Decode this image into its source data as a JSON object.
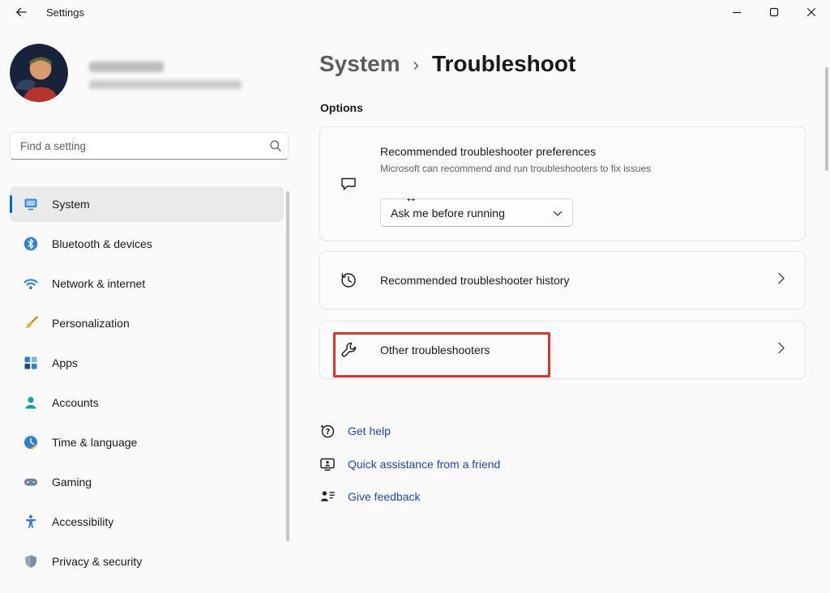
{
  "window": {
    "title": "Settings"
  },
  "sidebar": {
    "search_placeholder": "Find a setting",
    "nav_items": [
      {
        "label": "System",
        "icon": "system-monitor",
        "selected": true
      },
      {
        "label": "Bluetooth & devices",
        "icon": "bluetooth"
      },
      {
        "label": "Network & internet",
        "icon": "wifi"
      },
      {
        "label": "Personalization",
        "icon": "paintbrush"
      },
      {
        "label": "Apps",
        "icon": "apps-grid"
      },
      {
        "label": "Accounts",
        "icon": "person"
      },
      {
        "label": "Time & language",
        "icon": "clock"
      },
      {
        "label": "Gaming",
        "icon": "game-controller"
      },
      {
        "label": "Accessibility",
        "icon": "accessibility-person"
      },
      {
        "label": "Privacy & security",
        "icon": "shield"
      }
    ]
  },
  "main": {
    "breadcrumb": {
      "parent": "System",
      "separator": "›",
      "current": "Troubleshoot"
    },
    "section_title": "Options",
    "preferences_card": {
      "title": "Recommended troubleshooter preferences",
      "description": "Microsoft can recommend and run troubleshooters to fix issues",
      "dropdown_value": "Ask me before running",
      "icon": "speech-bubble"
    },
    "history_card": {
      "label": "Recommended troubleshooter history",
      "icon": "history-clock"
    },
    "other_card": {
      "label": "Other troubleshooters",
      "icon": "wrench"
    },
    "links": [
      {
        "label": "Get help",
        "icon": "help-question"
      },
      {
        "label": "Quick assistance from a friend",
        "icon": "remote-assist-screen"
      },
      {
        "label": "Give feedback",
        "icon": "feedback-person"
      }
    ]
  },
  "annotation": {
    "type": "red-highlight-box",
    "target": "Other troubleshooters",
    "color": "#d9352f"
  },
  "overlay": {
    "cursor_glyph": "↔"
  },
  "colors": {
    "accent_blue": "#0067c0",
    "link_blue": "#2246a8",
    "annotation_red": "#d9352f",
    "page_bg": "#fafafa",
    "card_bg": "#fbfbfb",
    "card_border": "#e5e5e5",
    "selected_item_bg": "#eaeaea",
    "text_primary": "#191919",
    "text_secondary": "#5f5f5f"
  }
}
